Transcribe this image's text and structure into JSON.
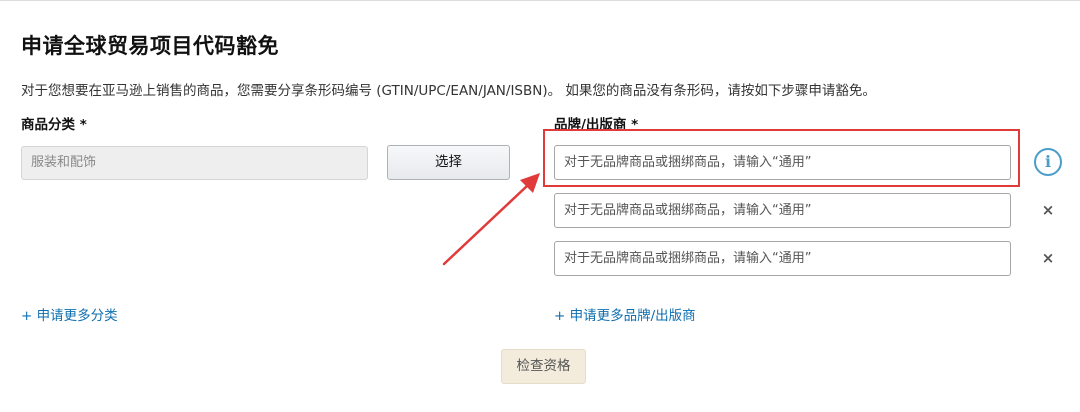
{
  "page": {
    "title": "申请全球贸易项目代码豁免",
    "description": "对于您想要在亚马逊上销售的商品，您需要分享条形码编号 (GTIN/UPC/EAN/JAN/ISBN)。 如果您的商品没有条形码，请按如下步骤申请豁免。"
  },
  "category": {
    "label": "商品分类 *",
    "value": "服装和配饰",
    "select_button": "选择",
    "add_more": "+ 申请更多分类"
  },
  "brand": {
    "label": "品牌/出版商 *",
    "inputs": [
      {
        "placeholder": "对于无品牌商品或捆绑商品，请输入“通用”"
      },
      {
        "placeholder": "对于无品牌商品或捆绑商品，请输入“通用”"
      },
      {
        "placeholder": "对于无品牌商品或捆绑商品，请输入“通用”"
      }
    ],
    "info_icon": "i",
    "remove_icon": "×",
    "add_more": "+ 申请更多品牌/出版商"
  },
  "actions": {
    "check_button": "检查资格"
  },
  "icons": {
    "info": "info-circle-icon",
    "remove": "close-icon"
  },
  "colors": {
    "annotation_red": "#e03a3a",
    "link_blue": "#0f6fb0",
    "info_blue": "#4a9cc9"
  }
}
